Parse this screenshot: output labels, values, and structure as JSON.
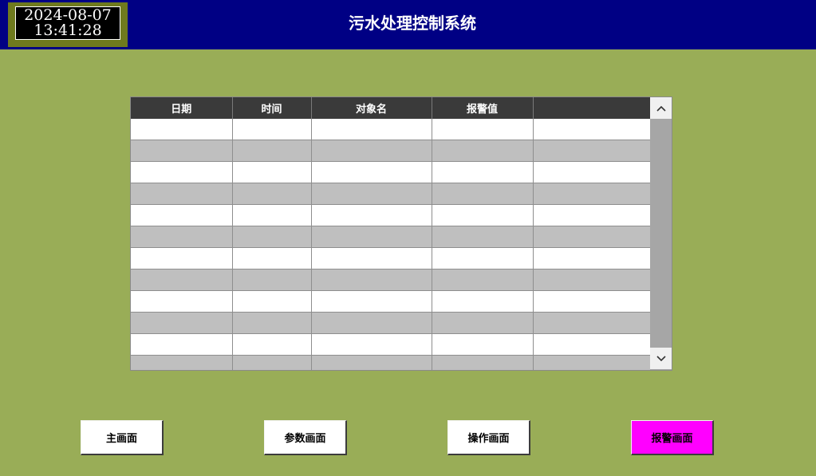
{
  "header": {
    "clock_date": "2024-08-07",
    "clock_time": "13:41:28",
    "title": "污水处理控制系统"
  },
  "alarm_table": {
    "columns": [
      "日期",
      "时间",
      "对象名",
      "报警值",
      ""
    ],
    "visible_rows": 12
  },
  "scrollbar": {
    "up_icon": "chevron-up-icon",
    "down_icon": "chevron-down-icon"
  },
  "nav": {
    "main_label": "主画面",
    "params_label": "参数画面",
    "operation_label": "操作画面",
    "alarm_label": "报警画面",
    "active": "alarm"
  },
  "colors": {
    "background": "#99ad57",
    "title_bar": "#000084",
    "table_header": "#3a3a3a",
    "active_nav": "#ff00ff"
  }
}
